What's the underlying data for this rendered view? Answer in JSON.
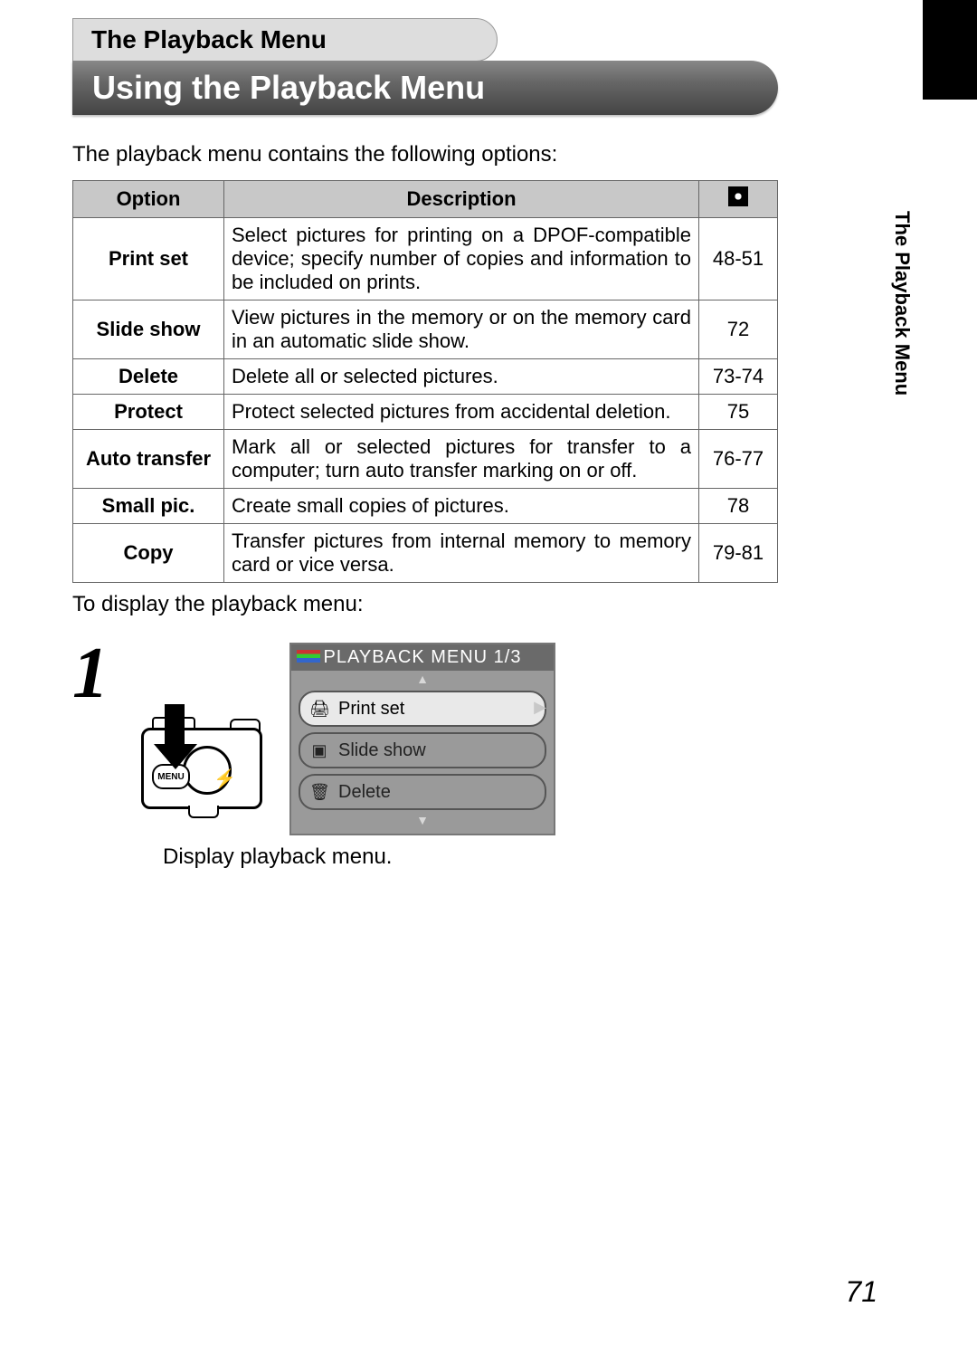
{
  "tab_label": "The Playback Menu",
  "heading": "Using the Playback Menu",
  "intro": "The playback menu contains the following options:",
  "table": {
    "headers": {
      "option": "Option",
      "description": "Description",
      "page_icon": "page-ref-icon"
    },
    "rows": [
      {
        "option": "Print set",
        "description": "Select pictures for printing on a DPOF-compatible device; specify number of copies and information to be included on prints.",
        "page": "48-51"
      },
      {
        "option": "Slide show",
        "description": "View pictures in the memory or on the memory card in an automatic slide show.",
        "page": "72"
      },
      {
        "option": "Delete",
        "description": "Delete all or selected pictures.",
        "page": "73-74"
      },
      {
        "option": "Protect",
        "description": "Protect selected pictures from accidental deletion.",
        "page": "75"
      },
      {
        "option": "Auto transfer",
        "description": "Mark all or selected pictures for transfer to a computer; turn auto transfer marking on or off.",
        "page": "76-77"
      },
      {
        "option": "Small pic.",
        "description": "Create small copies of pictures.",
        "page": "78"
      },
      {
        "option": "Copy",
        "description": "Transfer pictures from internal memory to memory card or vice versa.",
        "page": "79-81"
      }
    ]
  },
  "outro": "To display the playback menu:",
  "step": {
    "number": "1",
    "camera_menu_label": "MENU",
    "lcd": {
      "title": "PLAYBACK MENU  1/3",
      "items": [
        {
          "icon": "🖨",
          "label": "Print set",
          "selected": true
        },
        {
          "icon": "▣",
          "label": "Slide show",
          "selected": false
        },
        {
          "icon": "🗑",
          "label": "Delete",
          "selected": false
        }
      ]
    },
    "caption": "Display playback menu."
  },
  "side_label": "The Playback Menu",
  "page_number": "71"
}
